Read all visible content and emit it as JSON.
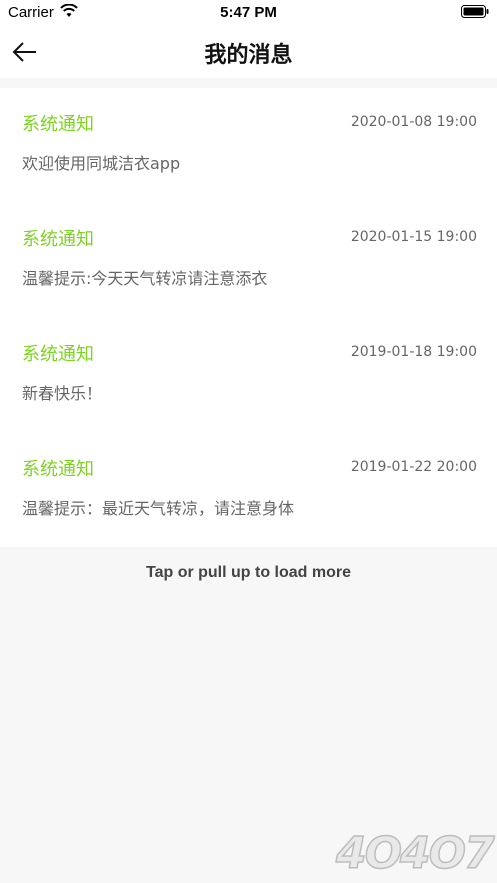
{
  "status_bar": {
    "carrier": "Carrier",
    "time": "5:47 PM"
  },
  "header": {
    "title": "我的消息"
  },
  "messages": [
    {
      "type": "系统通知",
      "time": "2020-01-08 19:00",
      "body": "欢迎使用同城洁衣app"
    },
    {
      "type": "系统通知",
      "time": "2020-01-15 19:00",
      "body": "温馨提示:今天天气转凉请注意添衣"
    },
    {
      "type": "系统通知",
      "time": "2019-01-18 19:00",
      "body": "新春快乐！"
    },
    {
      "type": "系统通知",
      "time": "2019-01-22 20:00",
      "body": "温馨提示：最近天气转凉，请注意身体"
    }
  ],
  "footer": {
    "load_more": "Tap or pull up to load more"
  },
  "watermark": {
    "text": "4O4O7"
  },
  "colors": {
    "accent_green": "#7ed321",
    "body_text": "#666666",
    "background": "#f7f7f7"
  }
}
